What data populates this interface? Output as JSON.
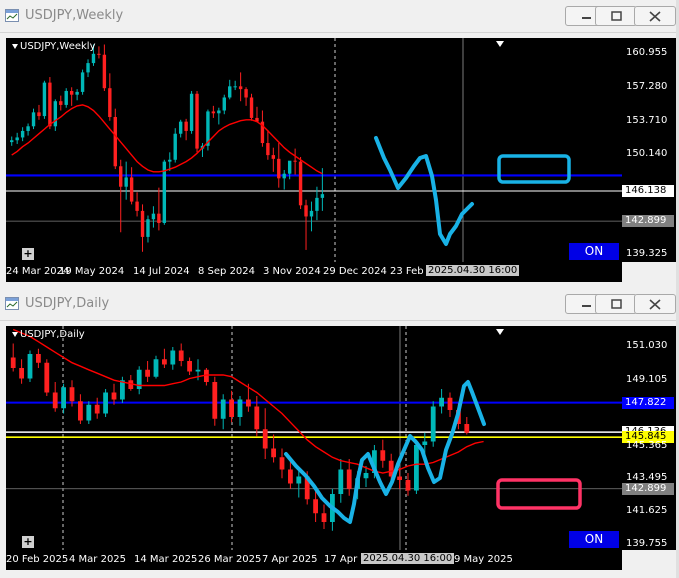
{
  "windows": [
    {
      "title": "USDJPY,Weekly",
      "symbol_label": "USDJPY,Weekly",
      "on_label": "ON",
      "crosshair_time": "2025.04.30 16:00",
      "price_tags": {
        "blue": "147.813",
        "white": "146.138",
        "grey": "142.899"
      },
      "colors": {
        "blue_line": "#0000ff",
        "white_line": "#ffffff",
        "ma": "#ff0000",
        "annotation": "#19b2e6"
      }
    },
    {
      "title": "USDJPY,Daily",
      "symbol_label": "USDJPY,Daily",
      "on_label": "ON",
      "crosshair_time": "2025.04.30 16:00",
      "price_tags": {
        "blue": "147.822",
        "white": "146.136",
        "yellow": "145.845",
        "grey": "142.899"
      },
      "colors": {
        "blue_line": "#0000ff",
        "yellow_line": "#ffff00",
        "ma": "#ff0000",
        "annotation": "#19b2e6",
        "box": "#ff3366"
      }
    }
  ],
  "chart_data": [
    {
      "type": "candlestick",
      "title": "USDJPY,Weekly",
      "y_ticks": [
        "160.955",
        "157.280",
        "153.710",
        "150.140",
        "146.138",
        "142.899",
        "139.325"
      ],
      "ylim": [
        138.5,
        162.6
      ],
      "x_ticks": [
        "24 Mar 2024",
        "19 May 2024",
        "14 Jul 2024",
        "8 Sep 2024",
        "3 Nov 2024",
        "29 Dec 2024",
        "23 Feb",
        "2025.04.30 16:00"
      ],
      "horizontal_lines": [
        147.813,
        146.138,
        142.899
      ],
      "moving_average": [
        150.0,
        150.4,
        150.9,
        151.3,
        151.8,
        152.3,
        152.8,
        153.3,
        153.7,
        154.1,
        154.6,
        155.0,
        155.3,
        155.4,
        155.2,
        154.8,
        154.2,
        153.5,
        152.8,
        152.1,
        151.4,
        150.7,
        150.0,
        149.3,
        148.8,
        148.4,
        148.2,
        148.2,
        148.3,
        148.5,
        148.7,
        149.0,
        149.3,
        149.7,
        150.2,
        150.8,
        151.4,
        152.0,
        152.6,
        153.0,
        153.3,
        153.5,
        153.7,
        153.8,
        153.8,
        153.6,
        153.2,
        152.6,
        152.0,
        151.4,
        150.8,
        150.3,
        149.9,
        149.5,
        149.1,
        148.7,
        148.3,
        148.0
      ],
      "candles": [
        [
          151.4,
          152.0,
          151.0,
          151.6
        ],
        [
          151.6,
          152.4,
          151.2,
          151.9
        ],
        [
          151.9,
          153.0,
          151.5,
          152.6
        ],
        [
          152.6,
          153.4,
          152.1,
          153.1
        ],
        [
          153.1,
          155.0,
          152.8,
          154.6
        ],
        [
          154.6,
          155.4,
          153.8,
          154.2
        ],
        [
          154.2,
          158.0,
          153.9,
          157.8
        ],
        [
          157.8,
          158.4,
          152.8,
          153.1
        ],
        [
          153.1,
          156.0,
          152.6,
          155.8
        ],
        [
          155.8,
          156.4,
          154.8,
          155.4
        ],
        [
          155.4,
          157.2,
          155.1,
          156.9
        ],
        [
          156.9,
          157.3,
          155.3,
          156.5
        ],
        [
          156.5,
          157.1,
          155.9,
          156.8
        ],
        [
          156.8,
          159.2,
          156.5,
          158.9
        ],
        [
          158.9,
          160.3,
          158.4,
          159.9
        ],
        [
          159.9,
          161.9,
          159.6,
          160.9
        ],
        [
          160.9,
          161.7,
          160.4,
          160.8
        ],
        [
          160.8,
          161.9,
          156.9,
          157.2
        ],
        [
          157.2,
          158.8,
          153.7,
          154.1
        ],
        [
          154.1,
          155.0,
          148.5,
          148.8
        ],
        [
          148.8,
          149.5,
          141.7,
          146.6
        ],
        [
          146.6,
          149.3,
          145.2,
          147.6
        ],
        [
          147.6,
          148.7,
          144.7,
          145.0
        ],
        [
          145.0,
          146.0,
          143.4,
          144.0
        ],
        [
          144.0,
          144.7,
          139.6,
          141.2
        ],
        [
          141.2,
          143.5,
          140.6,
          143.1
        ],
        [
          143.1,
          144.5,
          142.2,
          143.7
        ],
        [
          143.7,
          146.5,
          141.9,
          142.7
        ],
        [
          142.7,
          149.5,
          142.5,
          149.3
        ],
        [
          149.3,
          150.3,
          148.3,
          149.5
        ],
        [
          149.5,
          152.9,
          149.2,
          152.3
        ],
        [
          152.3,
          153.8,
          151.9,
          153.6
        ],
        [
          153.6,
          153.9,
          151.6,
          152.6
        ],
        [
          152.6,
          156.9,
          152.3,
          156.6
        ],
        [
          156.6,
          156.9,
          150.3,
          150.7
        ],
        [
          150.7,
          151.3,
          149.8,
          151.0
        ],
        [
          151.0,
          154.9,
          150.5,
          154.7
        ],
        [
          154.7,
          155.3,
          154.0,
          154.5
        ],
        [
          154.5,
          155.1,
          153.3,
          154.8
        ],
        [
          154.8,
          156.5,
          154.4,
          156.2
        ],
        [
          156.2,
          158.1,
          156.0,
          157.4
        ],
        [
          157.4,
          158.0,
          157.0,
          157.4
        ],
        [
          157.4,
          158.9,
          155.8,
          157.1
        ],
        [
          157.1,
          157.3,
          155.3,
          156.2
        ],
        [
          156.2,
          156.6,
          153.7,
          154.0
        ],
        [
          154.0,
          155.2,
          153.6,
          153.6
        ],
        [
          153.6,
          154.8,
          150.9,
          151.3
        ],
        [
          151.3,
          152.7,
          149.5,
          150.0
        ],
        [
          150.0,
          150.8,
          148.2,
          149.6
        ],
        [
          149.6,
          151.3,
          146.5,
          147.5
        ],
        [
          147.5,
          148.4,
          146.3,
          148.0
        ],
        [
          148.0,
          149.2,
          147.4,
          149.4
        ],
        [
          149.4,
          150.7,
          147.9,
          149.3
        ],
        [
          149.3,
          149.8,
          144.2,
          144.6
        ],
        [
          144.6,
          145.2,
          139.8,
          143.4
        ],
        [
          143.4,
          145.0,
          141.8,
          144.0
        ],
        [
          144.0,
          146.6,
          143.0,
          145.4
        ],
        [
          145.4,
          148.6,
          144.0,
          145.8
        ]
      ]
    },
    {
      "type": "candlestick",
      "title": "USDJPY,Daily",
      "y_ticks": [
        "151.030",
        "149.105",
        "147.822",
        "146.136",
        "145.845",
        "145.365",
        "143.495",
        "142.899",
        "141.625",
        "139.755"
      ],
      "ylim": [
        139.4,
        152.2
      ],
      "x_ticks": [
        "20 Feb 2025",
        "4 Mar 2025",
        "14 Mar 2025",
        "26 Mar 2025",
        "7 Apr 2025",
        "17 Apr",
        "2025.04.30 16:00",
        "9 May 2025"
      ],
      "horizontal_lines": [
        147.822,
        146.136,
        145.845,
        142.899
      ],
      "moving_average": [
        152.0,
        151.8,
        151.6,
        151.3,
        151.0,
        150.7,
        150.4,
        150.1,
        149.9,
        149.7,
        149.5,
        149.3,
        149.1,
        149.0,
        148.9,
        148.8,
        148.8,
        148.8,
        148.8,
        148.9,
        149.0,
        149.2,
        149.3,
        149.4,
        149.4,
        149.4,
        149.3,
        149.0,
        148.7,
        148.4,
        148.0,
        147.6,
        147.2,
        146.7,
        146.2,
        145.7,
        145.3,
        145.0,
        144.7,
        144.5,
        144.4,
        144.3,
        144.1,
        143.9,
        143.8,
        143.9,
        144.0,
        144.2,
        144.3,
        144.3,
        144.4,
        144.6,
        144.8,
        145.0,
        145.3,
        145.5,
        145.6
      ],
      "candles": [
        [
          150.4,
          151.2,
          149.6,
          149.8
        ],
        [
          149.8,
          150.3,
          148.9,
          149.2
        ],
        [
          149.2,
          150.8,
          149.0,
          150.6
        ],
        [
          150.6,
          150.9,
          149.8,
          150.1
        ],
        [
          150.1,
          150.3,
          148.2,
          148.4
        ],
        [
          148.4,
          149.0,
          147.3,
          147.5
        ],
        [
          147.5,
          148.9,
          147.2,
          148.7
        ],
        [
          148.7,
          149.1,
          147.6,
          147.9
        ],
        [
          147.9,
          148.3,
          146.6,
          146.8
        ],
        [
          146.8,
          147.9,
          146.6,
          147.7
        ],
        [
          147.7,
          148.1,
          146.9,
          147.2
        ],
        [
          147.2,
          148.6,
          147.0,
          148.4
        ],
        [
          148.4,
          148.9,
          147.7,
          148.0
        ],
        [
          148.0,
          149.3,
          147.8,
          149.1
        ],
        [
          149.1,
          149.4,
          148.5,
          148.6
        ],
        [
          148.6,
          149.9,
          148.3,
          149.7
        ],
        [
          149.7,
          150.2,
          149.0,
          149.3
        ],
        [
          149.3,
          150.5,
          149.2,
          150.3
        ],
        [
          150.3,
          150.9,
          149.8,
          150.0
        ],
        [
          150.0,
          151.0,
          149.7,
          150.8
        ],
        [
          150.8,
          151.2,
          149.9,
          150.2
        ],
        [
          150.2,
          150.4,
          149.4,
          149.6
        ],
        [
          149.6,
          150.3,
          149.1,
          149.7
        ],
        [
          149.7,
          149.8,
          148.8,
          149.0
        ],
        [
          149.0,
          149.3,
          146.5,
          146.9
        ],
        [
          146.9,
          148.3,
          146.3,
          148.0
        ],
        [
          148.0,
          148.5,
          146.7,
          147.0
        ],
        [
          147.0,
          148.2,
          146.5,
          148.0
        ],
        [
          148.0,
          148.9,
          147.3,
          147.6
        ],
        [
          147.6,
          148.2,
          145.9,
          146.3
        ],
        [
          146.3,
          147.5,
          144.6,
          145.2
        ],
        [
          145.2,
          146.0,
          144.4,
          144.7
        ],
        [
          144.7,
          145.2,
          143.5,
          144.0
        ],
        [
          144.0,
          144.6,
          142.9,
          143.2
        ],
        [
          143.2,
          144.1,
          142.4,
          143.6
        ],
        [
          143.6,
          143.9,
          142.0,
          142.3
        ],
        [
          142.3,
          142.8,
          141.0,
          141.5
        ],
        [
          141.5,
          142.0,
          140.6,
          141.0
        ],
        [
          141.0,
          142.9,
          140.5,
          142.6
        ],
        [
          142.6,
          144.6,
          142.1,
          144.0
        ],
        [
          144.0,
          144.6,
          142.5,
          142.9
        ],
        [
          142.9,
          143.9,
          142.3,
          143.5
        ],
        [
          143.5,
          144.2,
          143.0,
          143.8
        ],
        [
          143.8,
          145.4,
          143.5,
          145.1
        ],
        [
          145.1,
          145.7,
          144.1,
          144.5
        ],
        [
          144.5,
          144.9,
          143.1,
          143.6
        ],
        [
          143.6,
          144.1,
          142.9,
          143.4
        ],
        [
          143.4,
          143.8,
          142.5,
          142.8
        ],
        [
          142.8,
          145.7,
          142.6,
          145.4
        ],
        [
          145.4,
          146.1,
          144.8,
          145.6
        ],
        [
          145.6,
          147.9,
          145.3,
          147.6
        ],
        [
          147.6,
          148.6,
          147.2,
          148.1
        ],
        [
          148.1,
          148.4,
          147.0,
          147.4
        ],
        [
          147.4,
          147.8,
          146.3,
          146.6
        ],
        [
          146.6,
          147.0,
          146.0,
          146.1
        ]
      ]
    }
  ]
}
